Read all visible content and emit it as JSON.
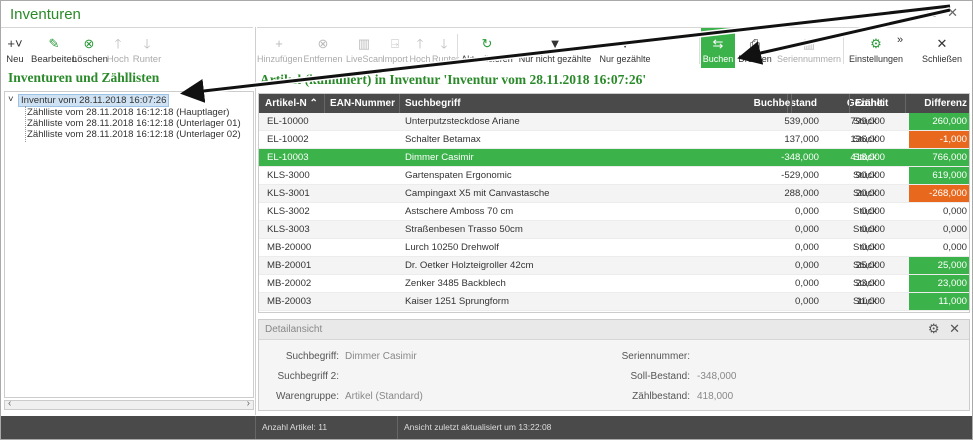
{
  "window": {
    "title": "Inventuren",
    "controls": "□ ✕"
  },
  "left_toolbar": [
    {
      "name": "new-button",
      "label": "Neu",
      "icon": "+˅",
      "disabled": false,
      "icon_name": "plus-icon"
    },
    {
      "name": "edit-button",
      "label": "Bearbeiten",
      "icon": "✎",
      "disabled": false,
      "icon_name": "edit-icon"
    },
    {
      "name": "delete-button",
      "label": "Löschen",
      "icon": "⊗",
      "disabled": false,
      "icon_name": "delete-icon"
    },
    {
      "name": "up-button",
      "label": "Hoch",
      "icon": "🡑",
      "disabled": true,
      "icon_name": "arrow-up-icon"
    },
    {
      "name": "down-button",
      "label": "Runter",
      "icon": "🡓",
      "disabled": true,
      "icon_name": "arrow-down-icon"
    }
  ],
  "left_panel": {
    "title": "Inventuren und Zähllisten",
    "tree": {
      "root": "Inventur vom 28.11.2018 16:07:26",
      "children": [
        "Zählliste vom 28.11.2018 16:12:18 (Hauptlager)",
        "Zählliste vom 28.11.2018 16:12:18 (Unterlager 01)",
        "Zählliste vom 28.11.2018 16:12:18 (Unterlager 02)"
      ]
    }
  },
  "right_toolbar": [
    {
      "name": "add-button",
      "label": "Hinzufügen",
      "icon": "+",
      "disabled": true
    },
    {
      "name": "remove-button",
      "label": "Entfernen",
      "icon": "⊗",
      "disabled": true
    },
    {
      "name": "livescan-button",
      "label": "LiveScan",
      "icon": "▥",
      "disabled": true
    },
    {
      "name": "import-button",
      "label": "Import",
      "icon": "⍈",
      "disabled": true
    },
    {
      "name": "up-button",
      "label": "Hoch",
      "icon": "🡑",
      "disabled": true
    },
    {
      "name": "down-button",
      "label": "Runter",
      "icon": "🡓",
      "disabled": true
    },
    {
      "name": "refresh-button",
      "label": "Aktualisieren",
      "icon": "↻",
      "disabled": false
    },
    {
      "name": "filter-not-counted-button",
      "label": "Nur nicht gezählte",
      "icon": "▼",
      "disabled": false
    },
    {
      "name": "filter-counted-button",
      "label": "Nur gezählte",
      "icon": "▼",
      "disabled": false
    },
    {
      "name": "book-button",
      "label": "Buchen",
      "icon": "⇆",
      "disabled": false
    },
    {
      "name": "print-button",
      "label": "Drucken",
      "icon": "⎙",
      "disabled": false
    },
    {
      "name": "serial-numbers-button",
      "label": "Seriennummern",
      "icon": "▥",
      "disabled": true
    },
    {
      "name": "settings-button",
      "label": "Einstellungen",
      "icon": "⚙",
      "disabled": false
    },
    {
      "name": "close-button",
      "label": "Schließen",
      "icon": "✕",
      "disabled": false
    }
  ],
  "more_icon": "»",
  "main_title": "Artikel (kumuliert) in Inventur 'Inventur vom 28.11.2018 16:07:26'",
  "table": {
    "columns": [
      "Artikel-N",
      "EAN-Nummer",
      "Suchbegriff",
      "Buchbestand",
      "Gezählt",
      "Einheit",
      "Differenz"
    ],
    "sort_indicator": "⌃",
    "rows": [
      {
        "artikel": "EL-10000",
        "ean": "",
        "such": "Unterputzsteckdose Ariane",
        "buch": "539,000",
        "gez": "799,000",
        "einheit": "Stück",
        "diff": "260,000",
        "diff_type": "pos"
      },
      {
        "artikel": "EL-10002",
        "ean": "",
        "such": "Schalter Betamax",
        "buch": "137,000",
        "gez": "136,000",
        "einheit": "Stück",
        "diff": "-1,000",
        "diff_type": "neg"
      },
      {
        "artikel": "EL-10003",
        "ean": "",
        "such": "Dimmer Casimir",
        "buch": "-348,000",
        "gez": "418,000",
        "einheit": "Stück",
        "diff": "766,000",
        "diff_type": "pos"
      },
      {
        "artikel": "KLS-3000",
        "ean": "",
        "such": "Gartenspaten Ergonomic",
        "buch": "-529,000",
        "gez": "90,000",
        "einheit": "Stück",
        "diff": "619,000",
        "diff_type": "pos"
      },
      {
        "artikel": "KLS-3001",
        "ean": "",
        "such": "Campingaxt X5 mit Canvastasche",
        "buch": "288,000",
        "gez": "20,000",
        "einheit": "Stück",
        "diff": "-268,000",
        "diff_type": "neg"
      },
      {
        "artikel": "KLS-3002",
        "ean": "",
        "such": "Astschere Amboss 70 cm",
        "buch": "0,000",
        "gez": "0,000",
        "einheit": "Stück",
        "diff": "0,000",
        "diff_type": "zero"
      },
      {
        "artikel": "KLS-3003",
        "ean": "",
        "such": "Straßenbesen Trasso 50cm",
        "buch": "0,000",
        "gez": "0,000",
        "einheit": "Stück",
        "diff": "0,000",
        "diff_type": "zero"
      },
      {
        "artikel": "MB-20000",
        "ean": "",
        "such": "Lurch 10250 Drehwolf",
        "buch": "0,000",
        "gez": "0,000",
        "einheit": "Stück",
        "diff": "0,000",
        "diff_type": "zero"
      },
      {
        "artikel": "MB-20001",
        "ean": "",
        "such": "Dr. Oetker Holzteigroller 42cm",
        "buch": "0,000",
        "gez": "25,000",
        "einheit": "Stück",
        "diff": "25,000",
        "diff_type": "pos"
      },
      {
        "artikel": "MB-20002",
        "ean": "",
        "such": "Zenker 3485 Backblech",
        "buch": "0,000",
        "gez": "23,000",
        "einheit": "Stück",
        "diff": "23,000",
        "diff_type": "pos"
      },
      {
        "artikel": "MB-20003",
        "ean": "",
        "such": "Kaiser 1251 Sprungform",
        "buch": "0,000",
        "gez": "11,000",
        "einheit": "Stück",
        "diff": "11,000",
        "diff_type": "pos"
      }
    ],
    "selected_row": 2
  },
  "details": {
    "title": "Detailansicht",
    "controls": "⚙ ✕",
    "suchbegriff_label": "Suchbegriff:",
    "suchbegriff": "Dimmer Casimir",
    "suchbegriff2_label": "Suchbegriff 2:",
    "suchbegriff2": "",
    "warengruppe_label": "Warengruppe:",
    "warengruppe": "Artikel (Standard)",
    "seriennummern_label": "Seriennummer:",
    "seriennummern": "",
    "soll_label": "Soll-Bestand:",
    "soll": "-348,000",
    "zaehl_label": "Zählbestand:",
    "zaehl": "418,000"
  },
  "status": {
    "count": "Anzahl Artikel: 11",
    "updated": "Ansicht zuletzt aktualisiert um 13:22:08"
  },
  "colors": {
    "accent": "#3bb34a",
    "negative": "#e8691e",
    "header": "#4a4a4a",
    "title_green": "#2a8a2a"
  }
}
